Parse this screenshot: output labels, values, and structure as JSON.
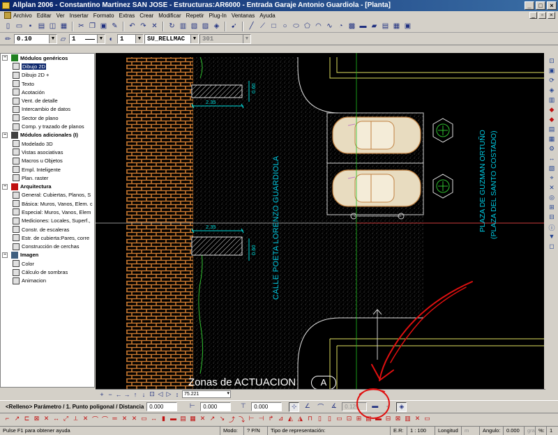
{
  "window": {
    "title": "Allplan 2006 - Constantino Martinez SAN JOSE - Estructuras:AR6000 - Entrada Garaje Antonio Guardiola - [Planta]",
    "minimize": "_",
    "maximize": "□",
    "close": "×"
  },
  "menu": {
    "items": [
      "Archivo",
      "Editar",
      "Ver",
      "Insertar",
      "Formato",
      "Extras",
      "Crear",
      "Modificar",
      "Repetir",
      "Plug-In",
      "Ventanas",
      "Ayuda"
    ]
  },
  "format_toolbar": {
    "pen_thickness": "0.10",
    "line_type": "1",
    "line_color": "1",
    "layer": "SU_RELLMAC",
    "layer_extra": "301"
  },
  "left_panel": {
    "groups": [
      {
        "label": "Módulos genéricos",
        "items": [
          "Dibujo 2D",
          "Dibujo 2D +",
          "Texto",
          "Acotación",
          "Vent. de detalle",
          "Intercambio de datos",
          "Sector de plano",
          "Comp. y trazado de planos"
        ]
      },
      {
        "label": "Módulos adicionales (I)",
        "items": [
          "Modelado 3D",
          "Vistas asociativas",
          "Macros u Objetos",
          "Empl. Inteligente",
          "Plan. raster"
        ]
      },
      {
        "label": "Arquitectura",
        "items": [
          "General: Cubiertas, Planos, S",
          "Básica: Muros, Vanos, Elem. c",
          "Especial: Muros, Vanos, Elem",
          "Mediciones: Locales, Superf.,",
          "Constr. de escaleras",
          "Estr. de cubierta:Pares, corre",
          "Construcción de cerchas"
        ]
      },
      {
        "label": "Imagen",
        "items": [
          "Color",
          "Cálculo de sombras",
          "Animacion"
        ]
      }
    ],
    "selected_item": "Dibujo 2D"
  },
  "drawing": {
    "street_label": "CALLE POETA LORENZO GUARDIOLA",
    "plaza_line1": "PLAZA DE GUZMAN ORTUÑO",
    "plaza_line2": "(PLAZA DEL SANTO COSTADO)",
    "zone_title": "Zonas de ACTUACION",
    "zone_letter": "A",
    "dim_top": "2.35",
    "dim_bottom": "2.35",
    "dim_vert_top": "0.60",
    "dim_vert_bottom": "0.60",
    "colors": {
      "background": "#000000",
      "brick": "#c87830",
      "cyan": "#00c8e0",
      "yellow": "#e0e060",
      "green": "#30c030",
      "annotation": "#e01010"
    }
  },
  "zoom_bar": {
    "zoom_value": "75.221"
  },
  "input_line": {
    "prompt": "<Relleno> Parámetro / 1. Punto poligonal / Distancia",
    "distance": "0.000",
    "dx": "0.000",
    "dy": "0.000",
    "angle": "0.125"
  },
  "status_bar": {
    "help": "Pulse F1 para obtener ayuda",
    "mode": "Modo:",
    "mode_value": "? P/N",
    "rep_type": "Tipo de representación:",
    "scale_label": "E.R:",
    "scale_value": "1 : 100",
    "unit_label": "Longitud",
    "unit_value": "m",
    "angle_label": "Angulo:",
    "angle_value": "0.000",
    "angle_unit": "gra",
    "percent": "%:",
    "percent_value": "1"
  }
}
